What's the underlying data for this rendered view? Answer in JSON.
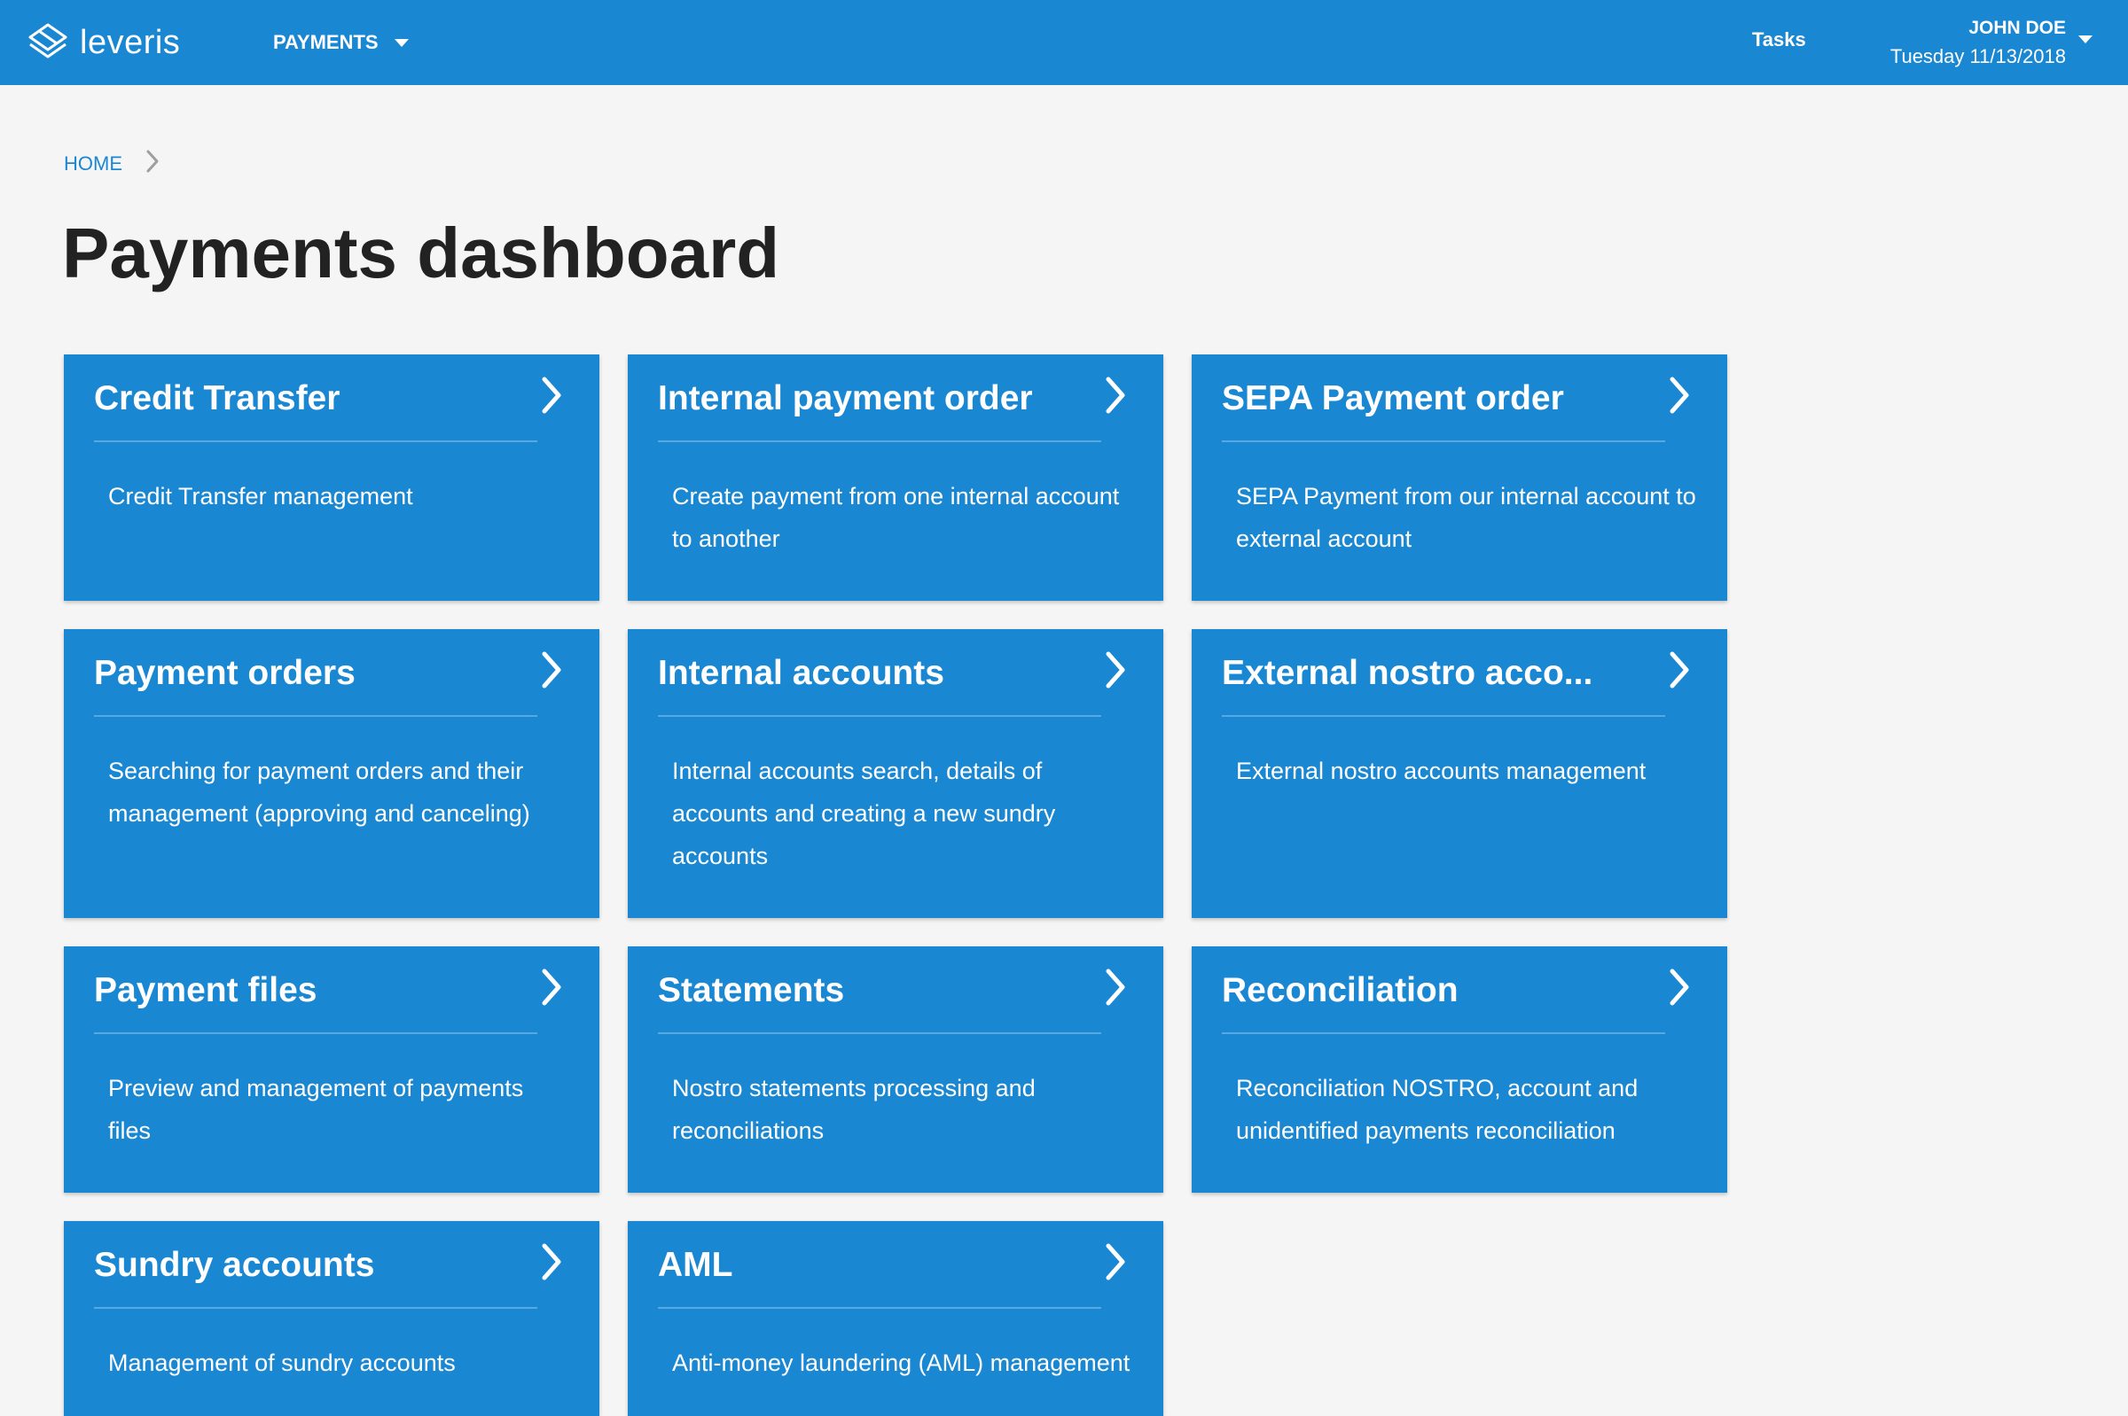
{
  "app": {
    "logo_text": "leveris",
    "colors": {
      "primary": "#1a87d3",
      "background": "#f5f5f5",
      "title_text": "#222222"
    }
  },
  "topbar": {
    "nav_payments": "PAYMENTS",
    "tasks": "Tasks",
    "user_name": "JOHN DOE",
    "user_date": "Tuesday 11/13/2018"
  },
  "breadcrumb": {
    "home": "HOME"
  },
  "page": {
    "title": "Payments dashboard"
  },
  "cards": [
    {
      "title": "Credit Transfer",
      "description": "Credit Transfer management"
    },
    {
      "title": "Internal payment order",
      "description": "Create payment from one internal account to another"
    },
    {
      "title": "SEPA Payment order",
      "description": "SEPA Payment from our internal account to external account"
    },
    {
      "title": "Payment orders",
      "description": "Searching for payment orders and their management (approving and canceling)"
    },
    {
      "title": "Internal accounts",
      "description": "Internal accounts search, details of accounts and creating a new sundry accounts"
    },
    {
      "title": "External nostro acco...",
      "description": "External nostro accounts management"
    },
    {
      "title": "Payment files",
      "description": "Preview and management of payments files"
    },
    {
      "title": "Statements",
      "description": "Nostro statements processing and reconciliations"
    },
    {
      "title": "Reconciliation",
      "description": "Reconciliation NOSTRO, account and unidentified payments reconciliation"
    },
    {
      "title": "Sundry accounts",
      "description": "Management of sundry accounts"
    },
    {
      "title": "AML",
      "description": "Anti-money laundering (AML) management"
    }
  ]
}
